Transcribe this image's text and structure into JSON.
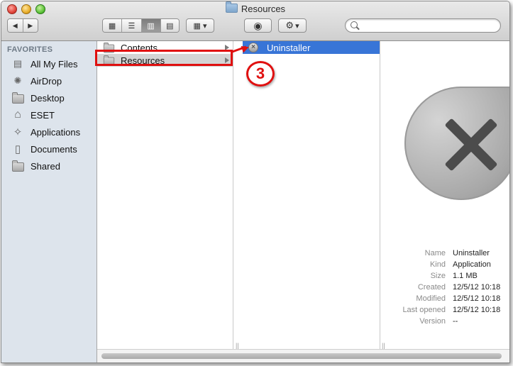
{
  "window": {
    "title": "Resources"
  },
  "toolbar": {
    "back_glyph": "◀",
    "forward_glyph": "▶",
    "view_icon_glyph": "▦",
    "view_list_glyph": "☰",
    "view_column_glyph": "▥",
    "view_coverflow_glyph": "▤",
    "arrange_glyph": "▦",
    "arrange_arrow": "▾",
    "quicklook_glyph": "◉",
    "action_glyph": "⚙",
    "action_arrow": "▾",
    "search_placeholder": ""
  },
  "sidebar": {
    "heading": "FAVORITES",
    "items": [
      {
        "label": "All My Files",
        "icon": "all-files-icon",
        "glyph": "▤"
      },
      {
        "label": "AirDrop",
        "icon": "airdrop-icon",
        "glyph": "✺"
      },
      {
        "label": "Desktop",
        "icon": "desktop-folder-icon",
        "glyph": ""
      },
      {
        "label": "ESET",
        "icon": "home-icon",
        "glyph": "⌂"
      },
      {
        "label": "Applications",
        "icon": "applications-icon",
        "glyph": "✧"
      },
      {
        "label": "Documents",
        "icon": "documents-icon",
        "glyph": "▯"
      },
      {
        "label": "Shared",
        "icon": "shared-folder-icon",
        "glyph": ""
      }
    ]
  },
  "columns": {
    "col1": [
      {
        "label": "Contents",
        "selected": false
      },
      {
        "label": "Resources",
        "selected": true
      }
    ],
    "col2": [
      {
        "label": "Uninstaller",
        "selected": true
      }
    ]
  },
  "preview": {
    "icon": "uninstaller-x-icon",
    "info": [
      {
        "key": "Name",
        "value": "Uninstaller"
      },
      {
        "key": "Kind",
        "value": "Application"
      },
      {
        "key": "Size",
        "value": "1.1 MB"
      },
      {
        "key": "Created",
        "value": "12/5/12 10:18"
      },
      {
        "key": "Modified",
        "value": "12/5/12 10:18"
      },
      {
        "key": "Last opened",
        "value": "12/5/12 10:18"
      },
      {
        "key": "Version",
        "value": "--"
      }
    ]
  },
  "annotation": {
    "step": "3",
    "color": "#e01010"
  },
  "colors": {
    "selection": "#3875d7",
    "sidebar_bg": "#dde4ec"
  }
}
